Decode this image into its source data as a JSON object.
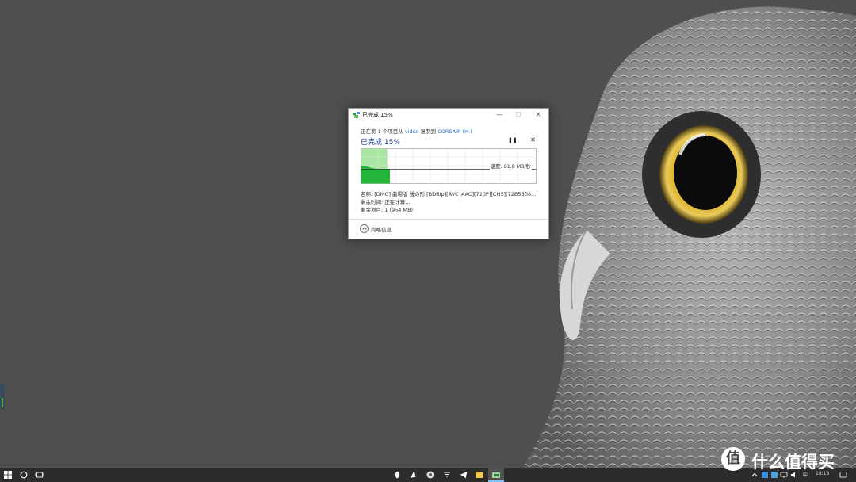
{
  "dialog": {
    "title": "已完成 15%",
    "window_controls": {
      "minimize": "—",
      "maximize": "☐",
      "close": "✕"
    },
    "operation": {
      "prefix": "正在将 1 个项目从 ",
      "source": "video",
      "middle": " 复制到 ",
      "destination": "CORSAIR (H:)"
    },
    "percent_heading": "已完成 15%",
    "progress": 0.15,
    "pause_label": "❚❚",
    "cancel_label": "✕",
    "speed_label": "速度: 81.8 MB/秒",
    "name_line": "名称: [DMG] 劇場版 聲の形 [BDRip][AVC_AAC][720P][CHS](72B5B08...",
    "time_line": "剩余时间: 正在计算...",
    "items_line": "剩余项目: 1 (964 MB)",
    "details_label": "简略信息"
  },
  "taskbar": {
    "clock": "18:18",
    "input_method": "中"
  },
  "watermark": {
    "logo_char": "值",
    "text": "什么值得买"
  },
  "colors": {
    "progress_fill": "#a8e6a1",
    "speed_area": "#22b53a",
    "link": "#1a6fc9"
  }
}
